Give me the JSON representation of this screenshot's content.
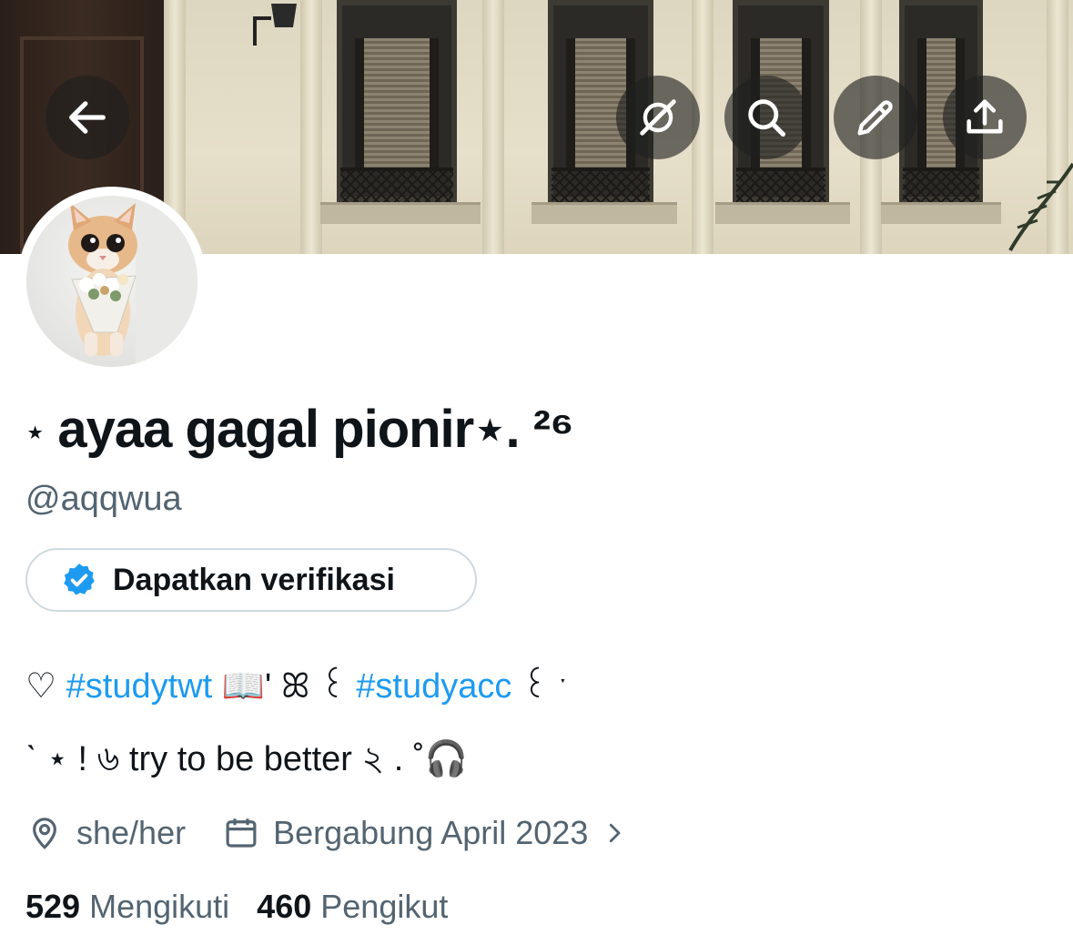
{
  "profile": {
    "display_name_prefix": "⋆",
    "display_name": " ayaa gagal pionir",
    "display_name_suffix": "⋆. ²⁶",
    "handle": "@aqqwua",
    "verify_label": "Dapatkan verifikasi",
    "bio_line1": {
      "heart": "♡",
      "tag1": "#studytwt",
      "mid": "📖' ꕤ ꒰ ",
      "tag2": "#studyacc",
      "end": " ꒰ ˑ"
    },
    "bio_line2": "ˋ ⋆ ! ৬ try to be better ২ . ˚🎧",
    "location": "she/her",
    "joined": "Bergabung April 2023",
    "following_count": "529",
    "following_label": "Mengikuti",
    "followers_count": "460",
    "followers_label": "Pengikut"
  },
  "icons": {
    "back": "arrow-left-icon",
    "unmute": "eye-slash-icon",
    "search": "search-icon",
    "edit": "pencil-icon",
    "share": "share-icon",
    "verified": "verified-badge-icon",
    "location": "location-pin-icon",
    "calendar": "calendar-icon",
    "chevron": "chevron-right-icon"
  },
  "colors": {
    "link": "#1d9bf0",
    "secondary_text": "#536471",
    "verified": "#1d9bf0"
  }
}
